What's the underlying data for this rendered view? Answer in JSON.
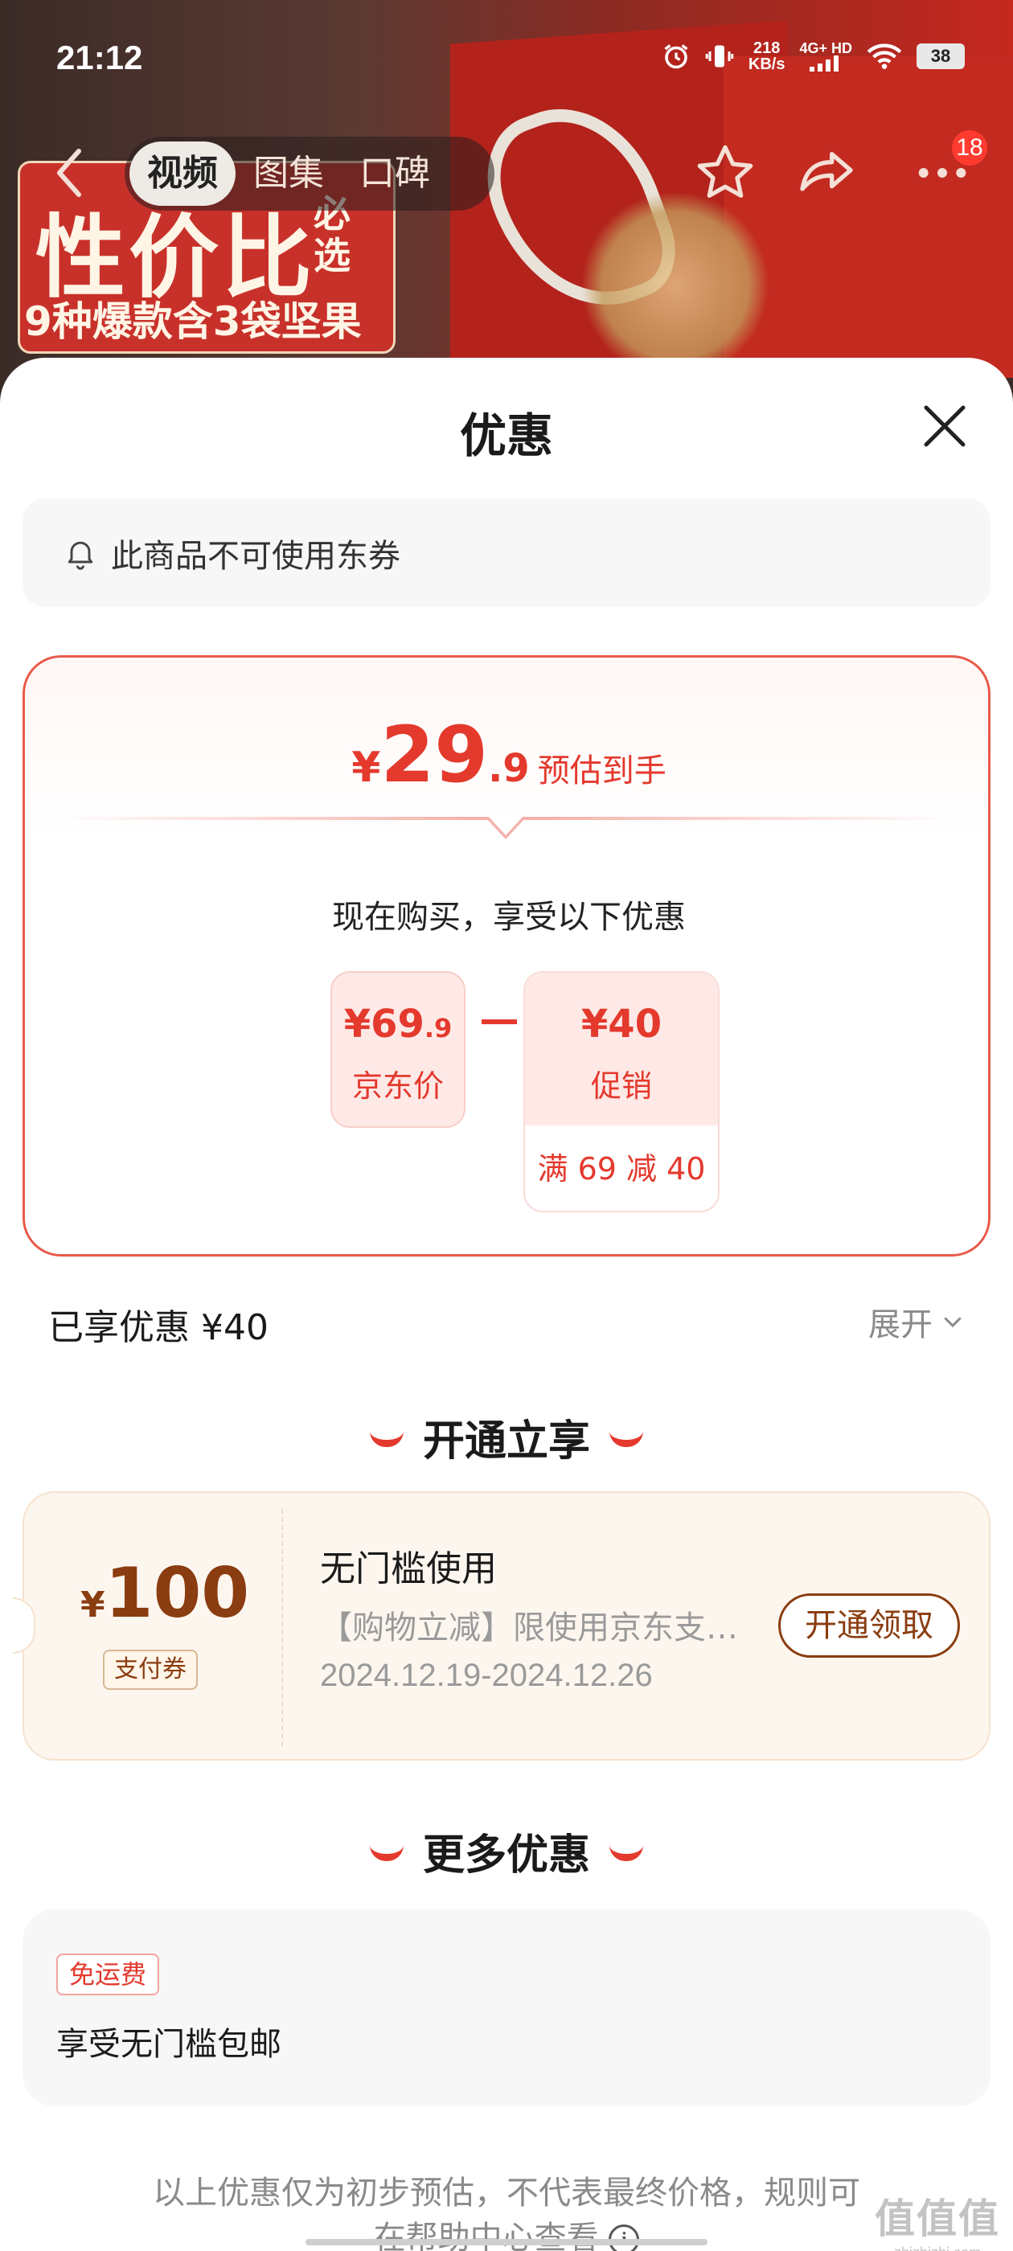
{
  "status_bar": {
    "time": "21:12",
    "net_speed_value": "218",
    "net_speed_unit": "KB/s",
    "signal_label": "4G+ HD",
    "battery": "38"
  },
  "product_bg": {
    "promo_title": "性价比",
    "promo_suffix": "必选",
    "promo_subtitle": "9种爆款含3袋坚果"
  },
  "top_nav": {
    "tabs": [
      {
        "label": "视频",
        "active": true
      },
      {
        "label": "图集",
        "active": false
      },
      {
        "label": "口碑",
        "active": false
      }
    ],
    "message_badge": "18",
    "icons": [
      "back-icon",
      "star-icon",
      "share-icon",
      "more-icon"
    ]
  },
  "sheet": {
    "title": "优惠",
    "notice": "此商品不可使用东券",
    "estimate": {
      "currency": "¥",
      "price_int": "29",
      "price_dec": ".9",
      "label": "预估到手"
    },
    "buy_now_text": "现在购买，享受以下优惠",
    "jd_price": {
      "currency": "¥",
      "value_int": "69",
      "value_dec": ".9",
      "label": "京东价"
    },
    "promotion": {
      "currency": "¥",
      "value": "40",
      "label": "促销",
      "rule": "满 69 减 40"
    },
    "enjoyed_text": "已享优惠 ¥40",
    "expand_label": "展开",
    "section_open": "开通立享",
    "coupon": {
      "currency": "¥",
      "value": "100",
      "tag": "支付券",
      "title": "无门槛使用",
      "desc": "【购物立减】限使用京东支付…",
      "date_range": "2024.12.19-2024.12.26",
      "button": "开通领取"
    },
    "section_more": "更多优惠",
    "more": {
      "tag": "免运费",
      "desc": "享受无门槛包邮"
    },
    "disclaimer_line1": "以上优惠仅为初步预估，不代表最终价格，规则可",
    "disclaimer_line2": "在帮助中心查看"
  },
  "watermark": {
    "big": "值值值",
    "small": "zhizhizhi.com"
  },
  "colors": {
    "accent_red": "#e4392d",
    "coupon_brown": "#8a3d10"
  }
}
